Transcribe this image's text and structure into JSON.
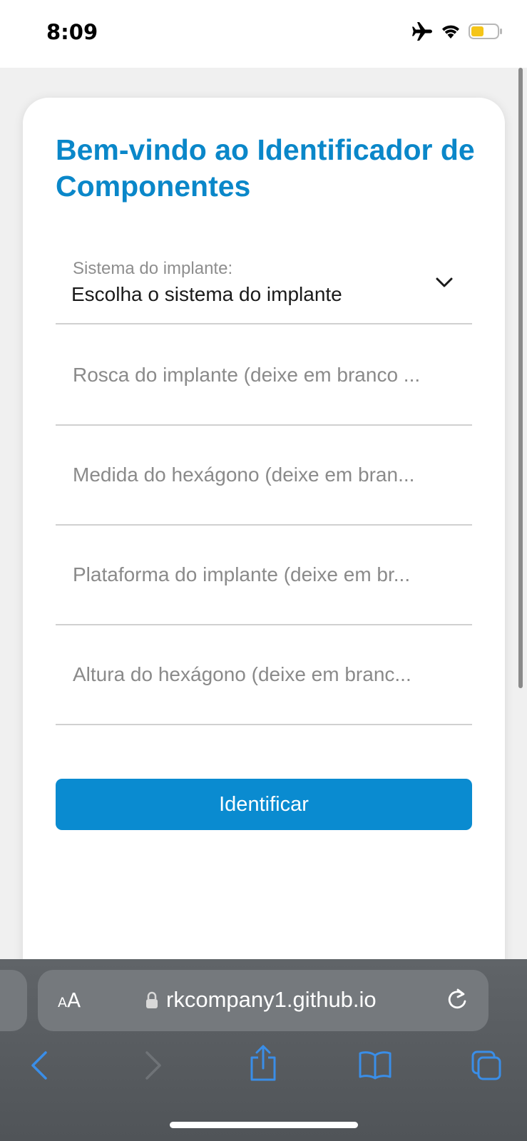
{
  "status_bar": {
    "time": "8:09",
    "icons": [
      "airplane-icon",
      "wifi-icon",
      "battery-icon"
    ],
    "battery_color": "#f5c518"
  },
  "card": {
    "title": "Bem-vindo ao Identificador de Componentes",
    "select": {
      "label": "Sistema do implante:",
      "value": "Escolha o sistema do implante"
    },
    "fields": [
      {
        "placeholder": "Rosca do implante (deixe em branco ..."
      },
      {
        "placeholder": "Medida do hexágono (deixe em bran..."
      },
      {
        "placeholder": "Plataforma do implante (deixe em br..."
      },
      {
        "placeholder": "Altura do hexágono (deixe em branc..."
      }
    ],
    "button_label": "Identificar"
  },
  "browser": {
    "aa_small": "A",
    "aa_big": "A",
    "url": "rkcompany1.github.io",
    "toolbar_icons": [
      "back-icon",
      "forward-icon",
      "share-icon",
      "bookmarks-icon",
      "tabs-icon"
    ]
  },
  "colors": {
    "title": "#0a87c9",
    "button": "#0a8bd0",
    "safari_accent": "#3a8ee8"
  }
}
